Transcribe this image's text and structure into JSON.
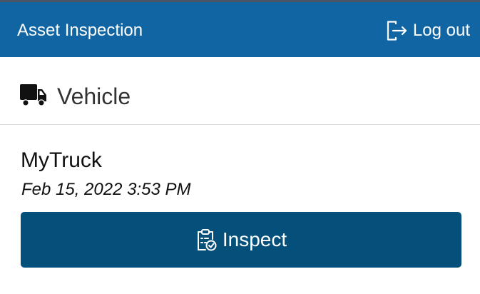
{
  "app": {
    "title": "Asset Inspection",
    "logout_label": "Log out",
    "logout_icon": "logout-icon"
  },
  "section": {
    "title": "Vehicle",
    "icon": "truck-icon"
  },
  "asset": {
    "name": "MyTruck",
    "timestamp": "Feb 15, 2022 3:53 PM"
  },
  "actions": {
    "inspect_label": "Inspect",
    "inspect_icon": "clipboard-check-icon"
  },
  "colors": {
    "navbar": "#1165a3",
    "button": "#054f7b",
    "top_strip": "#4b5563"
  }
}
